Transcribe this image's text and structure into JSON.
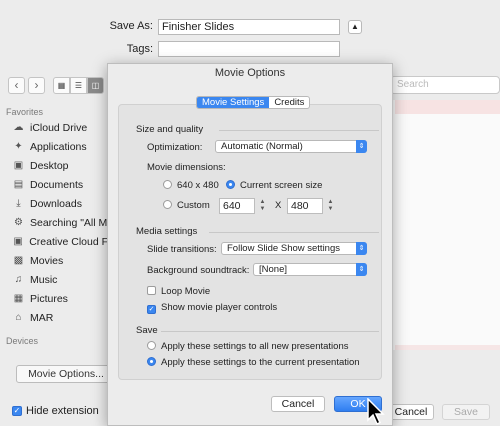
{
  "save_dialog": {
    "save_as_label": "Save As:",
    "save_as_value": "Finisher Slides",
    "tags_label": "Tags:",
    "tags_value": "",
    "search_placeholder": "Search"
  },
  "sidebar": {
    "favorites_header": "Favorites",
    "devices_header": "Devices",
    "items": [
      {
        "label": "iCloud Drive",
        "icon": "cloud-icon"
      },
      {
        "label": "Applications",
        "icon": "applications-icon"
      },
      {
        "label": "Desktop",
        "icon": "desktop-icon"
      },
      {
        "label": "Documents",
        "icon": "documents-icon"
      },
      {
        "label": "Downloads",
        "icon": "downloads-icon"
      },
      {
        "label": "Searching \"All M",
        "icon": "gear-folder-icon"
      },
      {
        "label": "Creative Cloud F",
        "icon": "folder-icon"
      },
      {
        "label": "Movies",
        "icon": "movies-icon"
      },
      {
        "label": "Music",
        "icon": "music-icon"
      },
      {
        "label": "Pictures",
        "icon": "pictures-icon"
      },
      {
        "label": "MAR",
        "icon": "home-icon"
      }
    ]
  },
  "bottom": {
    "movie_options_button": "Movie Options...",
    "hide_extension_label": "Hide extension",
    "hide_extension_checked": true,
    "cancel_button": "Cancel",
    "save_button": "Save"
  },
  "movie_options": {
    "title": "Movie Options",
    "tabs": [
      "Movie Settings",
      "Credits"
    ],
    "active_tab": "Movie Settings",
    "size_quality": {
      "header": "Size and quality",
      "optimization_label": "Optimization:",
      "optimization_value": "Automatic (Normal)",
      "dimensions_label": "Movie dimensions:",
      "option_640": "640 x 480",
      "option_current": "Current screen size",
      "option_custom": "Custom",
      "selected": "Current screen size",
      "custom_width": "640",
      "custom_x": "X",
      "custom_height": "480"
    },
    "media": {
      "header": "Media settings",
      "transitions_label": "Slide transitions:",
      "transitions_value": "Follow Slide Show settings",
      "soundtrack_label": "Background soundtrack:",
      "soundtrack_value": "[None]",
      "loop_movie_label": "Loop Movie",
      "loop_movie_checked": false,
      "show_controls_label": "Show movie player controls",
      "show_controls_checked": true
    },
    "save": {
      "header": "Save",
      "option_all": "Apply these settings to all new presentations",
      "option_current": "Apply these settings to the current presentation",
      "selected": "current"
    },
    "cancel_button": "Cancel",
    "ok_button": "OK"
  },
  "colors": {
    "accent": "#3b87f0",
    "window_bg": "#ececec"
  }
}
